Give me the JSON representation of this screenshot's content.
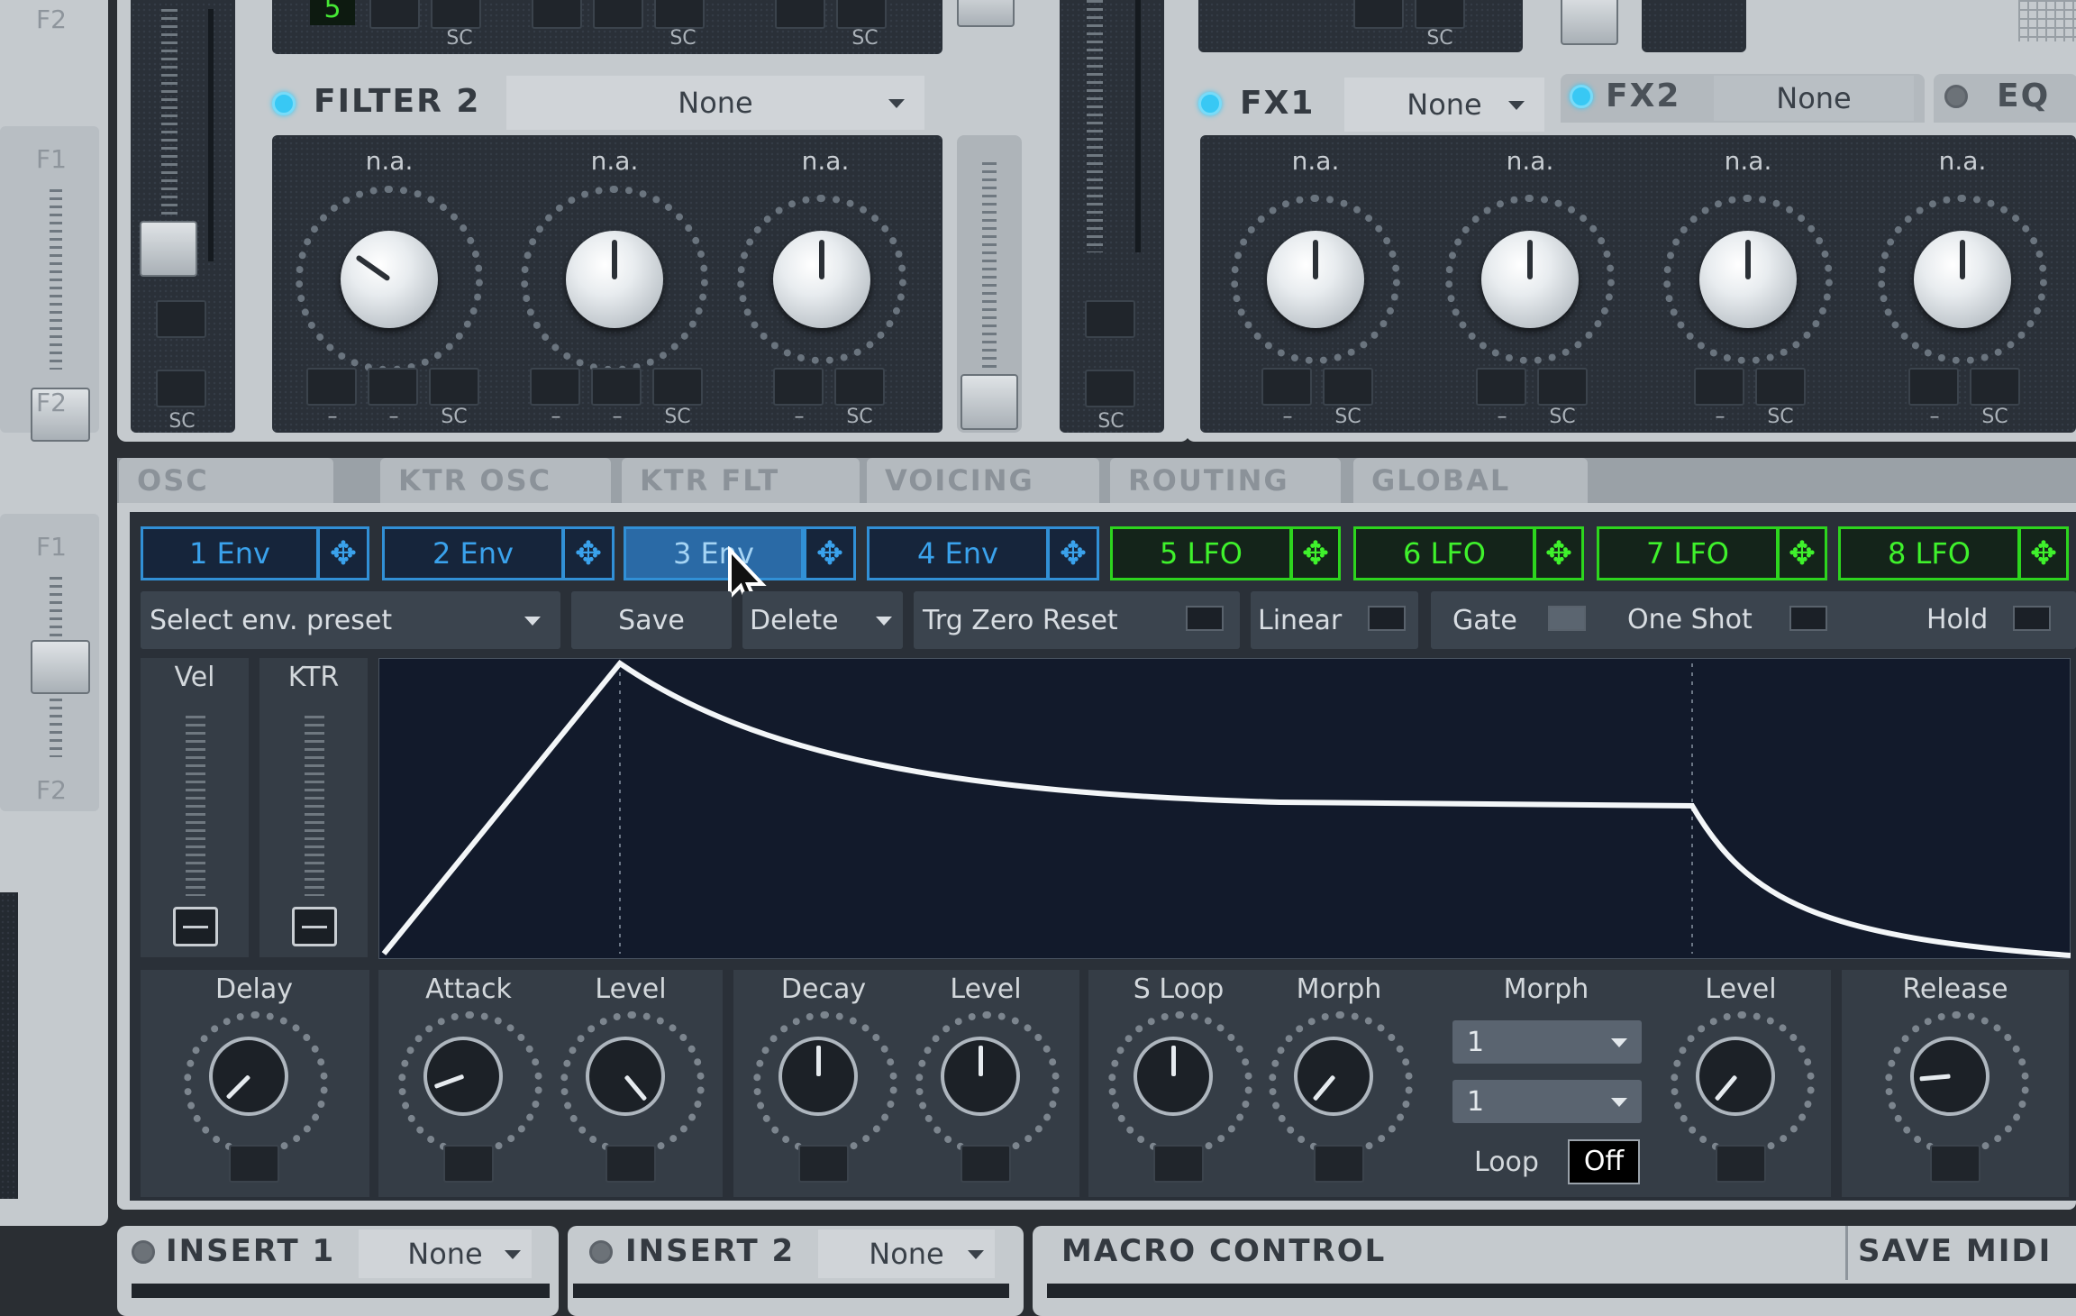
{
  "filter2": {
    "title": "FILTER 2",
    "type": "None",
    "knob_labels": [
      "n.a.",
      "n.a.",
      "n.a."
    ],
    "sc": "SC",
    "dash": "–"
  },
  "topstrip": {
    "display_value": "5"
  },
  "side": {
    "f1": "F1",
    "f2": "F2"
  },
  "fx1": {
    "title": "FX1",
    "type": "None"
  },
  "fx2": {
    "title": "FX2",
    "type": "None"
  },
  "eq": {
    "title": "EQ"
  },
  "fx_knobs": {
    "labels": [
      "n.a.",
      "n.a.",
      "n.a.",
      "n.a."
    ]
  },
  "tabs": [
    "OSC",
    "KTR OSC",
    "KTR FLT",
    "VOICING",
    "ROUTING",
    "GLOBAL"
  ],
  "env_tabs": [
    "1 Env",
    "2 Env",
    "3 Env",
    "4 Env"
  ],
  "lfo_tabs": [
    "5 LFO",
    "6 LFO",
    "7 LFO",
    "8 LFO"
  ],
  "move_icon": "move-arrows-icon",
  "controls": {
    "preset_select": "Select env. preset",
    "save": "Save",
    "delete": "Delete",
    "trg_zero_reset": "Trg Zero Reset",
    "linear": "Linear",
    "gate": "Gate",
    "one_shot": "One Shot",
    "hold": "Hold"
  },
  "vel_ktr": {
    "vel": "Vel",
    "ktr": "KTR"
  },
  "env_knobs": {
    "delay": "Delay",
    "attack": "Attack",
    "attack_level": "Level",
    "decay": "Decay",
    "decay_level": "Level",
    "s_loop": "S Loop",
    "morph": "Morph",
    "morph_header": "Morph",
    "morph_val1": "1",
    "morph_val2": "1",
    "loop_label": "Loop",
    "loop_value": "Off",
    "sustain_level": "Level",
    "release": "Release"
  },
  "bottom": {
    "insert1": "INSERT 1",
    "insert1_type": "None",
    "insert2": "INSERT 2",
    "insert2_type": "None",
    "macro": "MACRO CONTROL",
    "save_midi": "SAVE MIDI"
  },
  "colors": {
    "env_blue": "#3aa2ec",
    "lfo_green": "#3ff22c",
    "led_on": "#38c8f4",
    "panel": "#c5cace"
  }
}
